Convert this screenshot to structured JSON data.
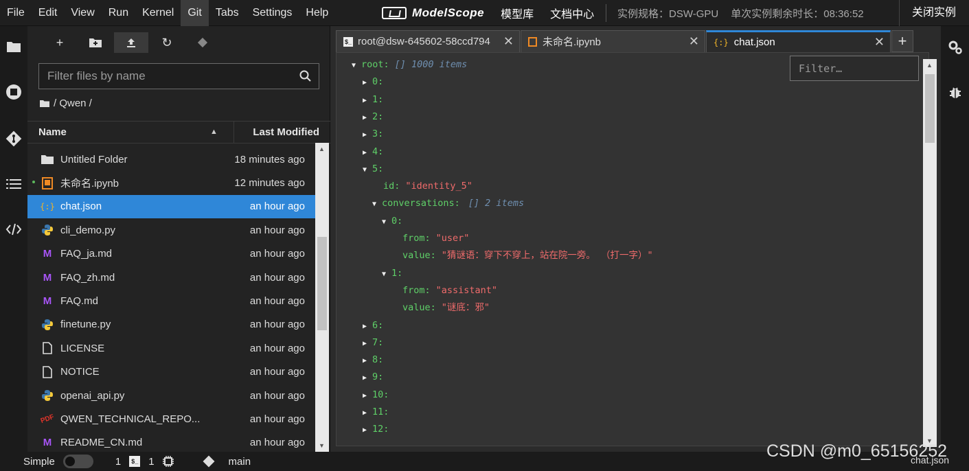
{
  "menubar": {
    "items": [
      "File",
      "Edit",
      "View",
      "Run",
      "Kernel",
      "Git",
      "Tabs",
      "Settings",
      "Help"
    ],
    "active": "Git",
    "brand": "ModelScope",
    "link_models": "模型库",
    "link_docs": "文档中心",
    "spec_label": "实例规格：DSW-GPU",
    "time_label": "单次实例剩余时长：08:36:52",
    "close_instance": "关闭实例"
  },
  "filebrowser": {
    "filter_placeholder": "Filter files by name",
    "breadcrumb": "/ Qwen /",
    "col_name": "Name",
    "col_modified": "Last Modified",
    "files": [
      {
        "name": "Untitled Folder",
        "modified": "18 minutes ago",
        "icon": "folder-icon",
        "running": false,
        "selected": false
      },
      {
        "name": "未命名.ipynb",
        "modified": "12 minutes ago",
        "icon": "notebook-icon",
        "running": true,
        "selected": false
      },
      {
        "name": "chat.json",
        "modified": "an hour ago",
        "icon": "json-icon",
        "running": false,
        "selected": true
      },
      {
        "name": "cli_demo.py",
        "modified": "an hour ago",
        "icon": "python-icon",
        "running": false,
        "selected": false
      },
      {
        "name": "FAQ_ja.md",
        "modified": "an hour ago",
        "icon": "markdown-icon",
        "running": false,
        "selected": false
      },
      {
        "name": "FAQ_zh.md",
        "modified": "an hour ago",
        "icon": "markdown-icon",
        "running": false,
        "selected": false
      },
      {
        "name": "FAQ.md",
        "modified": "an hour ago",
        "icon": "markdown-icon",
        "running": false,
        "selected": false
      },
      {
        "name": "finetune.py",
        "modified": "an hour ago",
        "icon": "python-icon",
        "running": false,
        "selected": false
      },
      {
        "name": "LICENSE",
        "modified": "an hour ago",
        "icon": "file-icon",
        "running": false,
        "selected": false
      },
      {
        "name": "NOTICE",
        "modified": "an hour ago",
        "icon": "file-icon",
        "running": false,
        "selected": false
      },
      {
        "name": "openai_api.py",
        "modified": "an hour ago",
        "icon": "python-icon",
        "running": false,
        "selected": false
      },
      {
        "name": "QWEN_TECHNICAL_REPO...",
        "modified": "an hour ago",
        "icon": "pdf-icon",
        "running": false,
        "selected": false
      },
      {
        "name": "README_CN.md",
        "modified": "an hour ago",
        "icon": "markdown-icon",
        "running": false,
        "selected": false
      }
    ]
  },
  "tabs": [
    {
      "label": "root@dsw-645602-58ccd794",
      "icon": "terminal-icon",
      "active": false
    },
    {
      "label": "未命名.ipynb",
      "icon": "notebook-icon",
      "active": false
    },
    {
      "label": "chat.json",
      "icon": "json-icon",
      "active": true
    }
  ],
  "json_viewer": {
    "filter_placeholder": "Filter…",
    "root_key": "root:",
    "root_meta": "[] 1000 items",
    "collapsed_before": [
      "0:",
      "1:",
      "2:",
      "3:",
      "4:"
    ],
    "expanded_key": "5:",
    "id_key": "id:",
    "id_value": "\"identity_5\"",
    "conv_key": "conversations:",
    "conv_meta": "[] 2 items",
    "turns": [
      {
        "key": "0:",
        "from_key": "from:",
        "from_value": "\"user\"",
        "value_key": "value:",
        "value_value": "\"猜谜语：穿下不穿上，站在院一旁。 （打一字）\""
      },
      {
        "key": "1:",
        "from_key": "from:",
        "from_value": "\"assistant\"",
        "value_key": "value:",
        "value_value": "\"谜底：邪\""
      }
    ],
    "collapsed_after": [
      "6:",
      "7:",
      "8:",
      "9:",
      "10:",
      "11:",
      "12:"
    ]
  },
  "statusbar": {
    "mode": "Simple",
    "terminals": "1",
    "kernels": "1",
    "branch": "main",
    "right_label": "chat.json"
  },
  "watermark": "CSDN @m0_65156252"
}
